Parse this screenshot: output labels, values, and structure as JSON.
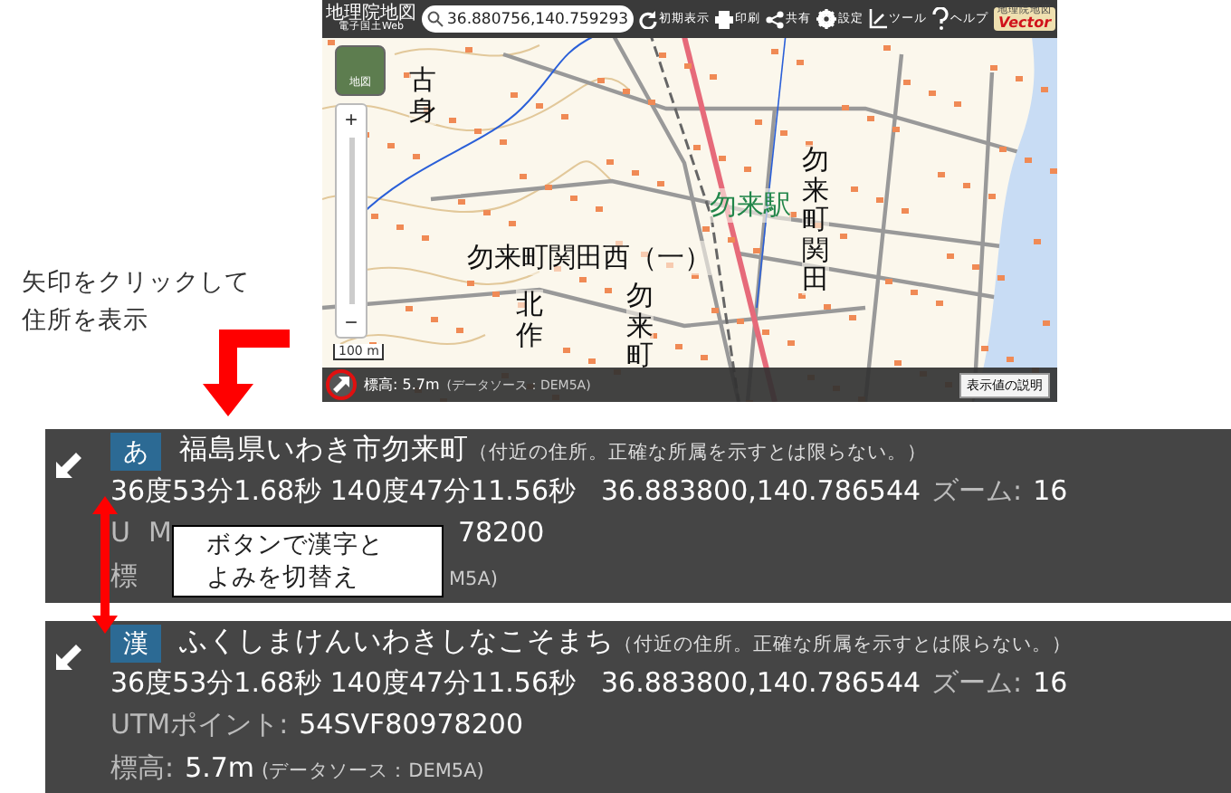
{
  "toolbar": {
    "logo_title": "地理院地図",
    "logo_subtitle": "電子国土Web",
    "search_value": "36.880756,140.759293",
    "buttons": [
      {
        "label": "初期表示"
      },
      {
        "label": "印刷"
      },
      {
        "label": "共有"
      },
      {
        "label": "設定"
      },
      {
        "label": "ツール"
      },
      {
        "label": "ヘルプ"
      }
    ],
    "badge_top": "地理院地図",
    "badge_bottom": "Vector"
  },
  "map": {
    "layer_button": "地図",
    "zoom_in": "+",
    "zoom_out": "−",
    "scale": "100 m",
    "labels": [
      {
        "text": "古身",
        "kind": "vertical"
      },
      {
        "text": "勿来駅",
        "kind": "station"
      },
      {
        "text": "勿来町関田",
        "kind": "vertical"
      },
      {
        "text": "勿来町関田西（一）",
        "kind": "horizontal"
      },
      {
        "text": "北作",
        "kind": "vertical"
      },
      {
        "text": "勿来町",
        "kind": "vertical"
      }
    ],
    "bottom_bar": {
      "elevation": "標高: 5.7m",
      "source": "(データソース：DEM5A)",
      "explain_button": "表示値の説明"
    }
  },
  "annotation": {
    "text_lines": [
      "矢印をクリックして",
      "住所を表示"
    ],
    "callout_lines": [
      "ボタンで漢字と",
      "よみを切替え"
    ]
  },
  "panels": [
    {
      "toggle": "あ",
      "address": "福島県いわき市勿来町",
      "note": "（付近の住所。正確な所属を示すとは限らない。）",
      "dms": "36度53分1.68秒 140度47分11.56秒",
      "decimal": "36.883800,140.786544",
      "zoom_label": "ズーム:",
      "zoom_value": "16",
      "utm_parts": [
        "U",
        "M",
        "78200"
      ],
      "elev_parts": [
        "標",
        "M5A)"
      ]
    },
    {
      "toggle": "漢",
      "address": "ふくしまけんいわきしなこそまち",
      "note": "（付近の住所。正確な所属を示すとは限らない。）",
      "dms": "36度53分1.68秒 140度47分11.56秒",
      "decimal": "36.883800,140.786544",
      "zoom_label": "ズーム:",
      "zoom_value": "16",
      "utm_label": "UTMポイント:",
      "utm_value": "54SVF80978200",
      "elev_label": "標高:",
      "elev_value": "5.7m",
      "elev_source": "(データソース：DEM5A)"
    }
  ]
}
